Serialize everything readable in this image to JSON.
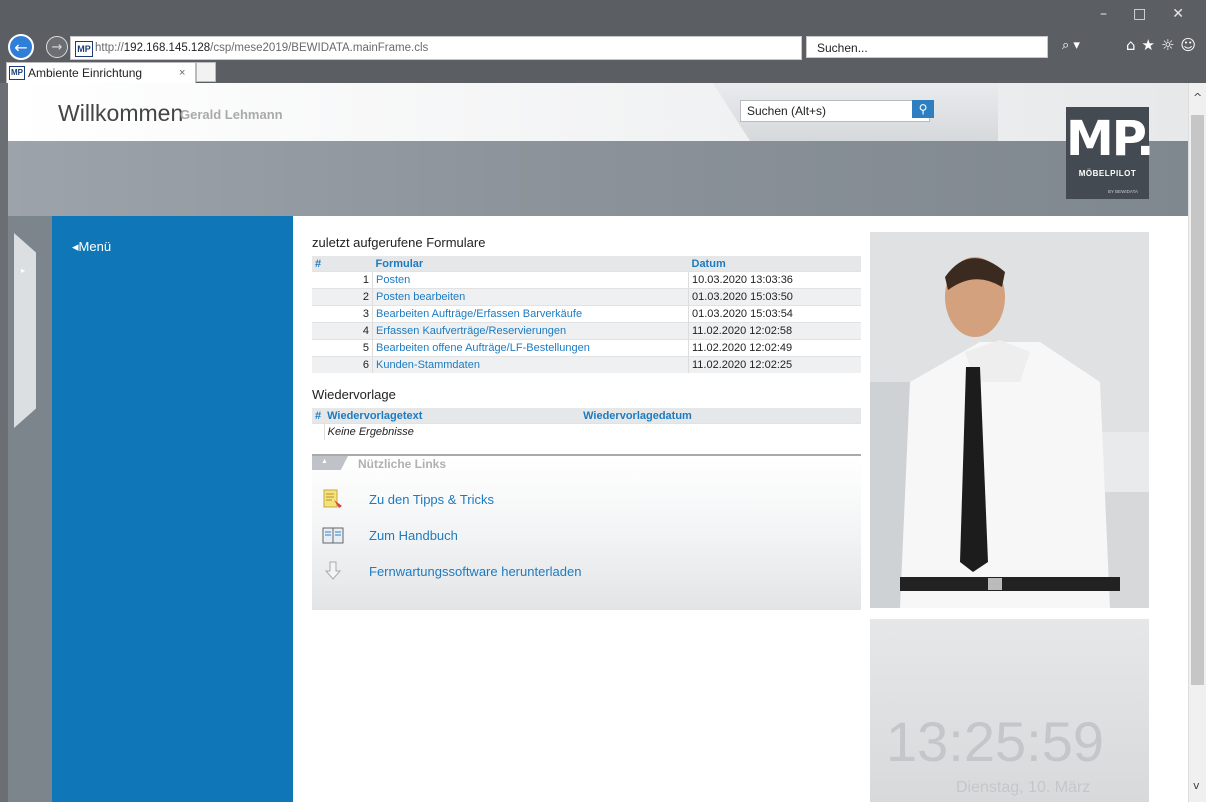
{
  "browser": {
    "url_prefix": "http://",
    "url_host": "192.168.145.128",
    "url_path": "/csp/mese2019/BEWIDATA.mainFrame.cls",
    "favicon_text": "MP",
    "addr_controls": "▾ C",
    "search_placeholder": "Suchen...",
    "search_icon": "⌕ ▾",
    "toolbar_icons": "⌂★☼☺",
    "window_controls": "–□✕",
    "tab_title": "Ambiente Einrichtung",
    "tab_close": "×"
  },
  "header": {
    "title": "Willkommen",
    "user": "Gerald Lehmann",
    "search_value": "Suchen (Alt+s)",
    "search_btn_icon": "⚲"
  },
  "logo": {
    "mark": "MP.",
    "name": "MÖBELPILOT",
    "sub": "BY BEWIDATA"
  },
  "menu": {
    "label": "◂Menü",
    "handle_icon": "▸"
  },
  "recent": {
    "title": "zuletzt aufgerufene Formulare",
    "col_num": "#",
    "col_form": "Formular",
    "col_date": "Datum",
    "rows": [
      {
        "num": "1",
        "form": "Posten",
        "date": "10.03.2020 13:03:36"
      },
      {
        "num": "2",
        "form": "Posten bearbeiten",
        "date": "01.03.2020 15:03:50"
      },
      {
        "num": "3",
        "form": "Bearbeiten Aufträge/Erfassen Barverkäufe",
        "date": "01.03.2020 15:03:54"
      },
      {
        "num": "4",
        "form": "Erfassen Kaufverträge/Reservierungen",
        "date": "11.02.2020 12:02:58"
      },
      {
        "num": "5",
        "form": "Bearbeiten offene Aufträge/LF-Bestellungen",
        "date": "11.02.2020 12:02:49"
      },
      {
        "num": "6",
        "form": "Kunden-Stammdaten",
        "date": "11.02.2020 12:02:25"
      }
    ]
  },
  "resubmission": {
    "title": "Wiedervorlage",
    "col_num": "#",
    "col_text": "Wiedervorlagetext",
    "col_date": "Wiedervorlagedatum",
    "empty": "Keine Ergebnisse"
  },
  "links": {
    "title": "Nützliche Links",
    "collapse_icon": "▲",
    "items": [
      {
        "label": "Zu den Tipps & Tricks",
        "icon": "tips-document-icon"
      },
      {
        "label": "Zum Handbuch",
        "icon": "handbook-icon"
      },
      {
        "label": "Fernwartungssoftware herunterladen",
        "icon": "download-arrow-icon"
      }
    ]
  },
  "clock": {
    "time": "13:25:59",
    "date": "Dienstag, 10. März"
  },
  "scrollbar": {
    "up": "^",
    "down": "v"
  }
}
